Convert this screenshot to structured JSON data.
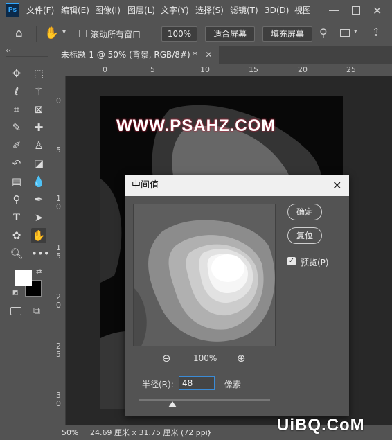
{
  "app": {
    "logo": "Ps"
  },
  "menu": [
    "文件(F)",
    "编辑(E)",
    "图像(I)",
    "图层(L)",
    "文字(Y)",
    "选择(S)",
    "滤镜(T)",
    "3D(D)",
    "视图"
  ],
  "options": {
    "scroll_all_windows": "滚动所有窗口",
    "zoom_value": "100%",
    "fit_screen": "适合屏幕",
    "fill_screen": "填充屏幕"
  },
  "tools": {
    "collapse": "‹‹",
    "icons": [
      "move-icon",
      "marquee-icon",
      "lasso-icon",
      "magic-wand-icon",
      "crop-icon",
      "frame-icon",
      "eyedropper-icon",
      "healing-icon",
      "brush-icon",
      "stamp-icon",
      "history-brush-icon",
      "eraser-icon",
      "gradient-icon",
      "blur-icon",
      "dodge-icon",
      "pen-icon",
      "type-icon",
      "path-select-icon",
      "shape-icon",
      "hand-icon",
      "zoom-icon",
      "more-icon"
    ],
    "foreground_color": "#ffffff",
    "background_color": "#000000"
  },
  "document": {
    "tab_title": "未标题-1 @ 50% (背景, RGB/8#) *",
    "artboard_text": "WWW.PSAHZ.COM",
    "ruler_top": [
      "0",
      "5",
      "10",
      "15",
      "20",
      "25"
    ],
    "ruler_left": [
      "0",
      "5",
      "1\n0",
      "1\n5",
      "2\n0",
      "2\n5",
      "3\n0"
    ]
  },
  "status": {
    "zoom": "50%",
    "doc_size": "24.69 厘米 x 31.75 厘米 (72 ppi)"
  },
  "dialog": {
    "title": "中间值",
    "ok": "确定",
    "reset": "复位",
    "preview_label": "预览(P)",
    "preview_checked": true,
    "preview_zoom": "100%",
    "radius_label": "半径(R):",
    "radius_value": "48",
    "radius_unit": "像素"
  },
  "watermark": "UiBQ.CoM"
}
